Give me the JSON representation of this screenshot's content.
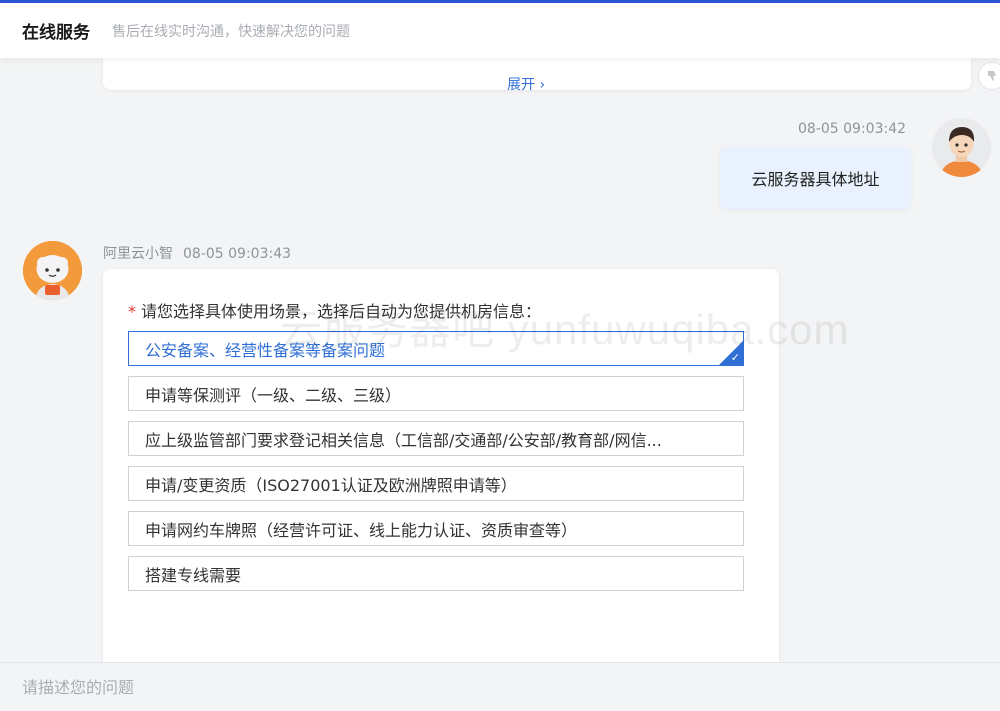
{
  "header": {
    "title": "在线服务",
    "subtitle": "售后在线实时沟通，快速解决您的问题"
  },
  "previous_card": {
    "expand_label": "展开 ›"
  },
  "user_message": {
    "timestamp": "08-05 09:03:42",
    "text": "云服务器具体地址"
  },
  "bot_message": {
    "name": "阿里云小智",
    "timestamp": "08-05 09:03:43",
    "required_mark": "*",
    "prompt": "请您选择具体使用场景，选择后自动为您提供机房信息：",
    "options": [
      {
        "label": "公安备案、经营性备案等备案问题",
        "selected": true
      },
      {
        "label": "申请等保测评（一级、二级、三级）",
        "selected": false
      },
      {
        "label": "应上级监管部门要求登记相关信息（工信部/交通部/公安部/教育部/网信...",
        "selected": false
      },
      {
        "label": "申请/变更资质（ISO27001认证及欧洲牌照申请等）",
        "selected": false
      },
      {
        "label": "申请网约车牌照（经营许可证、线上能力认证、资质审查等）",
        "selected": false
      },
      {
        "label": "搭建专线需要",
        "selected": false
      }
    ]
  },
  "watermark": "云服务器吧 yunfuwuqiba.com",
  "input": {
    "placeholder": "请描述您的问题",
    "value": ""
  },
  "colors": {
    "accent": "#2f6fd6",
    "top_line": "#2f54d6",
    "user_bubble": "#e8f1fd",
    "required": "#e03b2f",
    "bot_avatar": "#f39a3c"
  }
}
